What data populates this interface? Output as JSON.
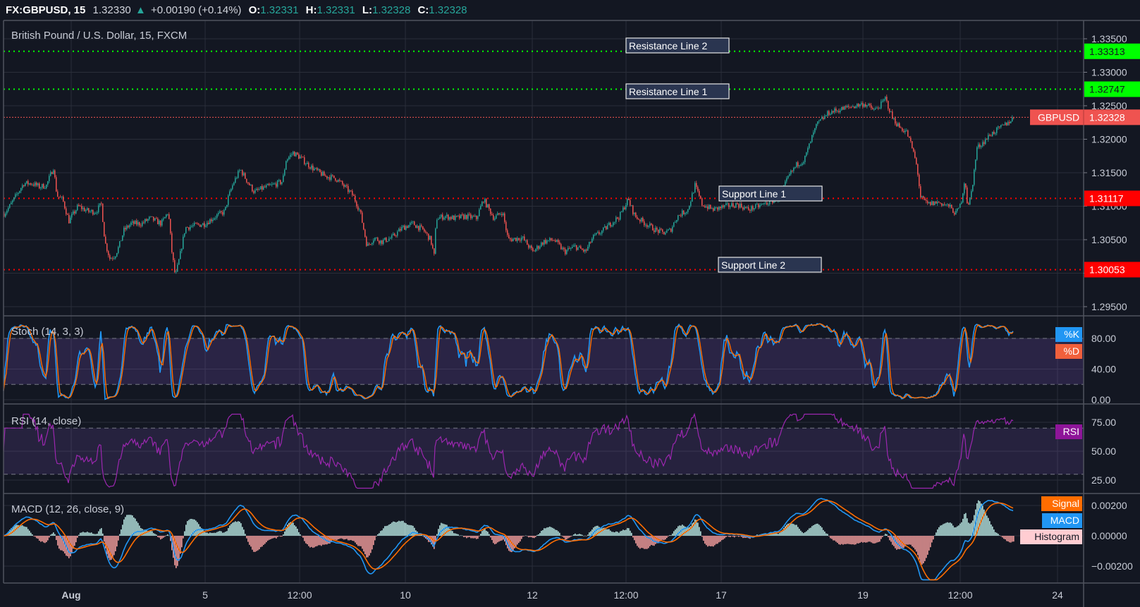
{
  "header": {
    "symbol": "FX:GBPUSD, 15",
    "last": "1.32330",
    "change_arrow": "▲",
    "change": "+0.00190 (+0.14%)",
    "o_label": "O:",
    "o_value": "1.32331",
    "h_label": "H:",
    "h_value": "1.32331",
    "l_label": "L:",
    "l_value": "1.32328",
    "c_label": "C:",
    "c_value": "1.32328"
  },
  "colors": {
    "background": "#131722",
    "up": "#26a69a",
    "down": "#ef5350",
    "resistance": "#00ff00",
    "support": "#ff0000",
    "stoch_k": "#2196f3",
    "stoch_d": "#ff6d00",
    "rsi": "#9c27b0",
    "macd": "#2196f3",
    "signal": "#ff6d00",
    "hist_up": "#b2dfdb",
    "hist_down": "#ef9a9a"
  },
  "chart_data": [
    {
      "type": "candlestick",
      "title": "British Pound / U.S. Dollar, 15, FXCM",
      "interval": "15",
      "ylim": [
        1.295,
        1.3365
      ],
      "y_ticks": [
        "1.33500",
        "1.33000",
        "1.32500",
        "1.32000",
        "1.31500",
        "1.31000",
        "1.30500",
        "1.30000",
        "1.29500"
      ],
      "x_ticks": [
        {
          "label": "Aug",
          "bar": 101
        },
        {
          "label": "5",
          "bar": 291
        },
        {
          "label": "12:00",
          "bar": 425
        },
        {
          "label": "10",
          "bar": 575
        },
        {
          "label": "12",
          "bar": 755
        },
        {
          "label": "12:00",
          "bar": 888
        },
        {
          "label": "17",
          "bar": 1023
        },
        {
          "label": "19",
          "bar": 1224
        },
        {
          "label": "12:00",
          "bar": 1362
        },
        {
          "label": "24",
          "bar": 1500
        }
      ],
      "grid": true,
      "price_path": [
        [
          5,
          1.3089
        ],
        [
          13,
          1.31
        ],
        [
          25,
          1.3121
        ],
        [
          33,
          1.3134
        ],
        [
          45,
          1.3134
        ],
        [
          55,
          1.3129
        ],
        [
          65,
          1.3131
        ],
        [
          75,
          1.3158
        ],
        [
          80,
          1.3116
        ],
        [
          88,
          1.311
        ],
        [
          97,
          1.3078
        ],
        [
          110,
          1.31
        ],
        [
          125,
          1.3092
        ],
        [
          135,
          1.3092
        ],
        [
          143,
          1.3103
        ],
        [
          148,
          1.3047
        ],
        [
          155,
          1.3022
        ],
        [
          162,
          1.3026
        ],
        [
          168,
          1.304
        ],
        [
          175,
          1.3064
        ],
        [
          185,
          1.3074
        ],
        [
          200,
          1.3074
        ],
        [
          212,
          1.3082
        ],
        [
          228,
          1.3074
        ],
        [
          238,
          1.3092
        ],
        [
          243,
          1.3032
        ],
        [
          248,
          1.2994
        ],
        [
          255,
          1.3029
        ],
        [
          262,
          1.3068
        ],
        [
          275,
          1.3071
        ],
        [
          290,
          1.3074
        ],
        [
          305,
          1.3085
        ],
        [
          318,
          1.3092
        ],
        [
          323,
          1.3113
        ],
        [
          330,
          1.3134
        ],
        [
          340,
          1.3155
        ],
        [
          350,
          1.3137
        ],
        [
          360,
          1.3121
        ],
        [
          372,
          1.3127
        ],
        [
          385,
          1.3131
        ],
        [
          400,
          1.3137
        ],
        [
          405,
          1.3169
        ],
        [
          415,
          1.318
        ],
        [
          425,
          1.3173
        ],
        [
          435,
          1.3163
        ],
        [
          445,
          1.3155
        ],
        [
          460,
          1.3145
        ],
        [
          475,
          1.3142
        ],
        [
          490,
          1.3127
        ],
        [
          500,
          1.3116
        ],
        [
          510,
          1.3092
        ],
        [
          520,
          1.304
        ],
        [
          530,
          1.3053
        ],
        [
          540,
          1.3047
        ],
        [
          555,
          1.3053
        ],
        [
          570,
          1.3068
        ],
        [
          585,
          1.3074
        ],
        [
          600,
          1.3064
        ],
        [
          610,
          1.305
        ],
        [
          615,
          1.3026
        ],
        [
          618,
          1.3082
        ],
        [
          630,
          1.3085
        ],
        [
          645,
          1.3082
        ],
        [
          660,
          1.3085
        ],
        [
          675,
          1.3082
        ],
        [
          685,
          1.311
        ],
        [
          700,
          1.3082
        ],
        [
          712,
          1.3092
        ],
        [
          720,
          1.305
        ],
        [
          740,
          1.3053
        ],
        [
          755,
          1.3032
        ],
        [
          770,
          1.3047
        ],
        [
          785,
          1.305
        ],
        [
          800,
          1.3032
        ],
        [
          815,
          1.304
        ],
        [
          830,
          1.3032
        ],
        [
          840,
          1.3053
        ],
        [
          855,
          1.3064
        ],
        [
          865,
          1.3074
        ],
        [
          878,
          1.3085
        ],
        [
          890,
          1.311
        ],
        [
          900,
          1.3085
        ],
        [
          915,
          1.3074
        ],
        [
          930,
          1.3064
        ],
        [
          940,
          1.306
        ],
        [
          950,
          1.3064
        ],
        [
          960,
          1.3085
        ],
        [
          975,
          1.3095
        ],
        [
          985,
          1.3131
        ],
        [
          995,
          1.3103
        ],
        [
          1010,
          1.3095
        ],
        [
          1030,
          1.31
        ],
        [
          1045,
          1.3103
        ],
        [
          1060,
          1.3095
        ],
        [
          1075,
          1.31
        ],
        [
          1090,
          1.3106
        ],
        [
          1105,
          1.3113
        ],
        [
          1118,
          1.3145
        ],
        [
          1130,
          1.3163
        ],
        [
          1140,
          1.3169
        ],
        [
          1150,
          1.32
        ],
        [
          1158,
          1.3222
        ],
        [
          1175,
          1.324
        ],
        [
          1200,
          1.3247
        ],
        [
          1225,
          1.3253
        ],
        [
          1240,
          1.3243
        ],
        [
          1250,
          1.3253
        ],
        [
          1255,
          1.3261
        ],
        [
          1265,
          1.3232
        ],
        [
          1275,
          1.3218
        ],
        [
          1285,
          1.3211
        ],
        [
          1290,
          1.3197
        ],
        [
          1295,
          1.318
        ],
        [
          1300,
          1.3158
        ],
        [
          1305,
          1.3113
        ],
        [
          1315,
          1.3103
        ],
        [
          1330,
          1.3106
        ],
        [
          1345,
          1.31
        ],
        [
          1355,
          1.3089
        ],
        [
          1362,
          1.3103
        ],
        [
          1368,
          1.3142
        ],
        [
          1372,
          1.3095
        ],
        [
          1378,
          1.3127
        ],
        [
          1385,
          1.3187
        ],
        [
          1395,
          1.3197
        ],
        [
          1405,
          1.3208
        ],
        [
          1420,
          1.3218
        ],
        [
          1430,
          1.3226
        ],
        [
          1438,
          1.3233
        ]
      ],
      "current_price": {
        "label": "GBPUSD",
        "value": "1.32328",
        "price": 1.32328
      },
      "levels": [
        {
          "name": "Resistance Line 2",
          "value": "1.33313",
          "price": 1.33313,
          "kind": "resistance"
        },
        {
          "name": "Resistance Line 1",
          "value": "1.32747",
          "price": 1.32747,
          "kind": "resistance"
        },
        {
          "name": "Support Line 1",
          "value": "1.31117",
          "price": 1.31117,
          "kind": "support"
        },
        {
          "name": "Support Line 2",
          "value": "1.30053",
          "price": 1.30053,
          "kind": "support"
        }
      ]
    },
    {
      "type": "line",
      "title": "Stoch (14, 3, 3)",
      "ylim": [
        0,
        100
      ],
      "y_ticks": [
        "80.00",
        "40.00",
        "0.00"
      ],
      "band": [
        20,
        80
      ],
      "series": [
        {
          "name": "%K"
        },
        {
          "name": "%D"
        }
      ]
    },
    {
      "type": "line",
      "title": "RSI (14, close)",
      "ylim": [
        15,
        85
      ],
      "y_ticks": [
        "75.00",
        "50.00",
        "25.00"
      ],
      "band": [
        30,
        70
      ],
      "series": [
        {
          "name": "RSI"
        }
      ]
    },
    {
      "type": "line",
      "title": "MACD (12, 26, close, 9)",
      "ylim": [
        -0.003,
        0.003
      ],
      "y_ticks": [
        "0.00200",
        "0.00000",
        "−0.00200"
      ],
      "series": [
        {
          "name": "Signal"
        },
        {
          "name": "MACD"
        },
        {
          "name": "Histogram"
        }
      ]
    }
  ]
}
